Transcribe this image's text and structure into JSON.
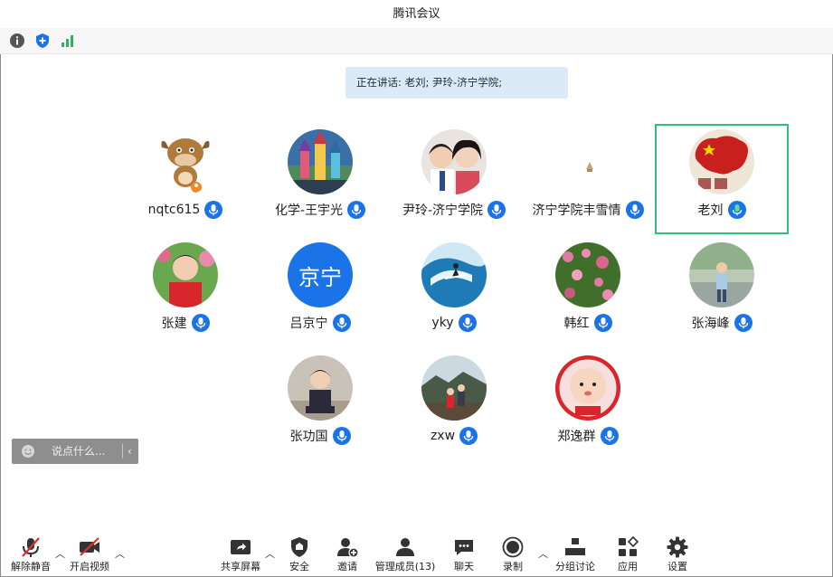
{
  "window": {
    "title": "腾讯会议"
  },
  "status_icons": [
    {
      "icon": "info-icon"
    },
    {
      "icon": "shield-icon"
    },
    {
      "icon": "signal-bars-icon"
    }
  ],
  "speaking": {
    "text": "正在讲话: 老刘; 尹玲-济宁学院;"
  },
  "participants": [
    {
      "name": "nqtc615"
    },
    {
      "name": "化学-王宇光"
    },
    {
      "name": "尹玲-济宁学院"
    },
    {
      "name": "济宁学院丰雪情"
    },
    {
      "name": "老刘"
    },
    {
      "name": "张建"
    },
    {
      "name": "吕京宁",
      "avatar_text": "京宁"
    },
    {
      "name": "yky"
    },
    {
      "name": "韩红"
    },
    {
      "name": "张海峰"
    },
    {
      "name": "张功国"
    },
    {
      "name": "zxw"
    },
    {
      "name": "郑逸群"
    }
  ],
  "chat": {
    "placeholder": "说点什么..."
  },
  "toolbar": {
    "unmute": "解除静音",
    "start_video": "开启视频",
    "share_screen": "共享屏幕",
    "security": "安全",
    "invite": "邀请",
    "manage_members": "管理成员(13)",
    "chat": "聊天",
    "record": "录制",
    "breakout": "分组讨论",
    "apps": "应用",
    "settings": "设置"
  },
  "colors": {
    "accent": "#1a74e8",
    "active_border": "#2fc07a",
    "speaking_bg": "#dce9f7"
  }
}
